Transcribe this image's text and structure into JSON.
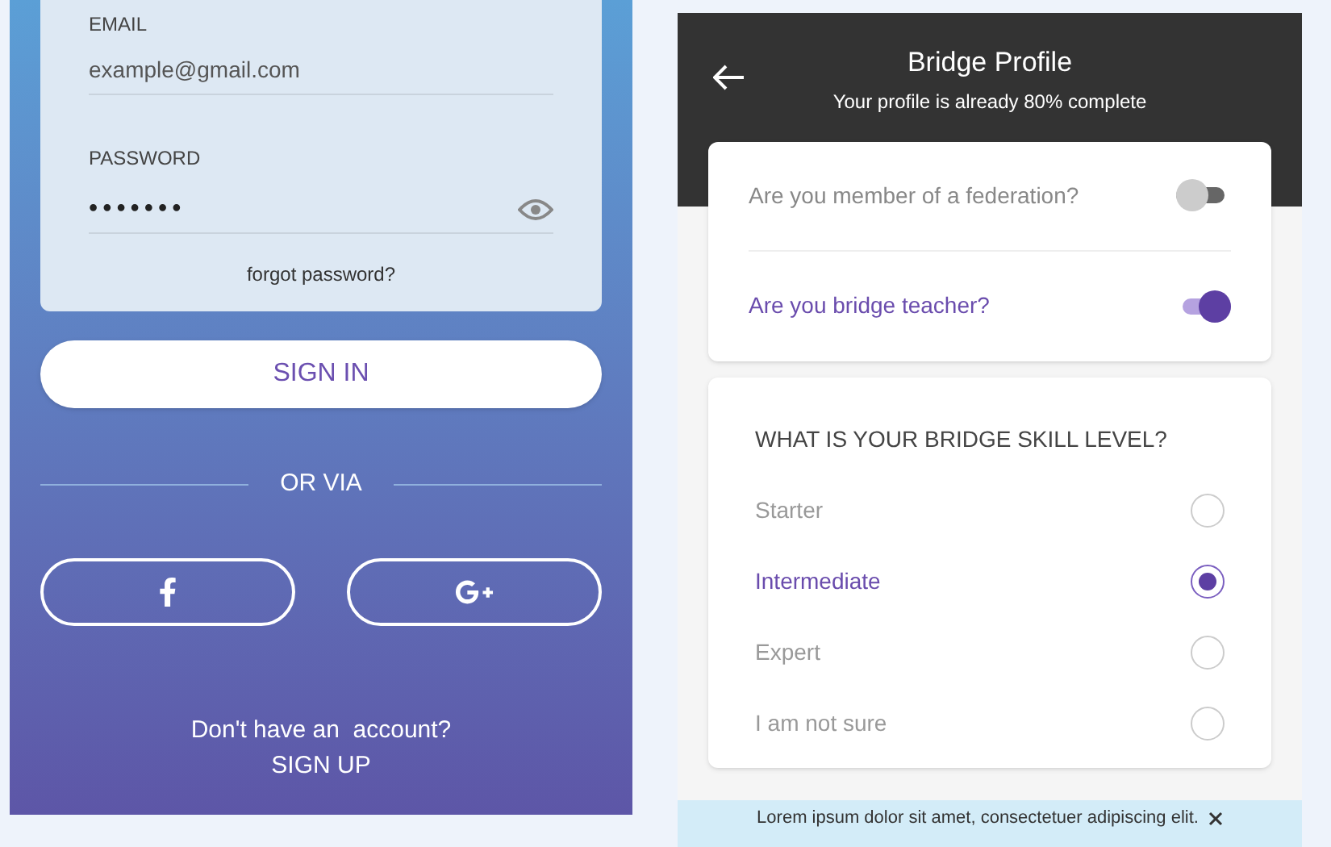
{
  "login": {
    "email": {
      "label": "EMAIL",
      "value": "example@gmail.com"
    },
    "password": {
      "label": "PASSWORD",
      "value": "•••••••"
    },
    "forgot": "forgot password?",
    "sign_in": "SIGN IN",
    "divider": "OR VIA",
    "social": [
      {
        "kind": "facebook"
      },
      {
        "kind": "google"
      }
    ],
    "signup_prompt": "Don't have an  account?",
    "signup": "SIGN UP"
  },
  "profile": {
    "title": "Bridge Profile",
    "subtitle": "Your profile is already 80% complete",
    "toggles": [
      {
        "label": "Are you member of a federation?",
        "on": false
      },
      {
        "label": "Are you bridge teacher?",
        "on": true
      }
    ],
    "question": "WHAT IS YOUR BRIDGE SKILL LEVEL?",
    "options": [
      {
        "label": "Starter",
        "selected": false
      },
      {
        "label": "Intermediate",
        "selected": true
      },
      {
        "label": "Expert",
        "selected": false
      },
      {
        "label": "I am not sure",
        "selected": false
      }
    ],
    "banner": "Lorem ipsum dolor sit amet, consectetuer adipiscing elit."
  }
}
